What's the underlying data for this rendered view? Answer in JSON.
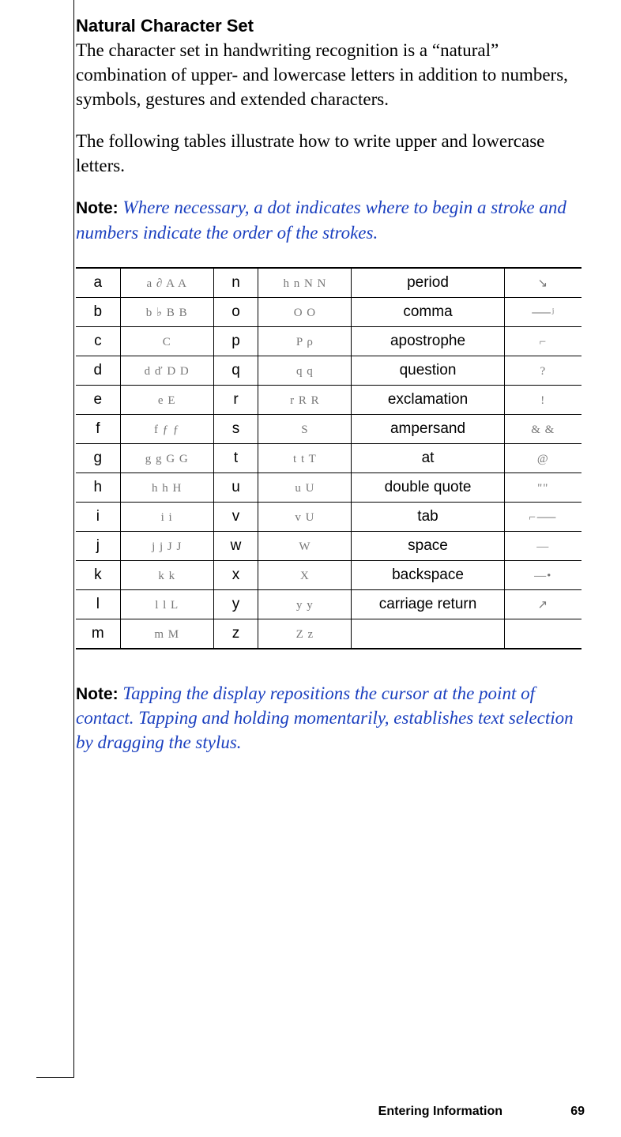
{
  "section": {
    "title": "Natural Character Set",
    "para1": "The character set in handwriting recognition is a “natural” combination of upper- and lowercase letters in addition to numbers, symbols, gestures and extended characters.",
    "para2": "The following tables illustrate how to write upper and lowercase letters."
  },
  "notes": {
    "label": "Note:",
    "note1": "Where necessary, a dot indicates where to begin a stroke and numbers indicate the order of the strokes.",
    "note2": "Tapping the display repositions the cursor at the point of contact. Tapping and holding momentarily, establishes text selection by dragging the stylus."
  },
  "table": {
    "rows": [
      {
        "l1": "a",
        "l2": "n",
        "p": "period"
      },
      {
        "l1": "b",
        "l2": "o",
        "p": "comma"
      },
      {
        "l1": "c",
        "l2": "p",
        "p": "apostrophe"
      },
      {
        "l1": "d",
        "l2": "q",
        "p": "question"
      },
      {
        "l1": "e",
        "l2": "r",
        "p": "exclamation"
      },
      {
        "l1": "f",
        "l2": "s",
        "p": "ampersand"
      },
      {
        "l1": "g",
        "l2": "t",
        "p": "at"
      },
      {
        "l1": "h",
        "l2": "u",
        "p": "double quote"
      },
      {
        "l1": "i",
        "l2": "v",
        "p": "tab"
      },
      {
        "l1": "j",
        "l2": "w",
        "p": "space"
      },
      {
        "l1": "k",
        "l2": "x",
        "p": "backspace"
      },
      {
        "l1": "l",
        "l2": "y",
        "p": "carriage return"
      },
      {
        "l1": "m",
        "l2": "z",
        "p": ""
      }
    ]
  },
  "footer": {
    "chapter": "Entering Information",
    "page": "69"
  },
  "glyph_hints": {
    "a": "a ∂ A A",
    "b": "b ♭ B B",
    "c": "C",
    "d": "d ď D D",
    "e": "e E",
    "f": "f ƒ ƒ",
    "g": "g g G G",
    "h": "h h H",
    "i": "i i",
    "j": "j j J J",
    "k": "k k",
    "l": "l l L",
    "m": "m M",
    "n": "h n N N",
    "o": "O O",
    "p": "P ρ",
    "q": "q q",
    "r": "r R R",
    "s": "S",
    "t": "t t T",
    "u": "u U",
    "v": "v U",
    "w": "W",
    "x": "X",
    "y": "y y",
    "z": "Z z",
    "period": "↘",
    "comma": "⸺ʲ",
    "apostrophe": "⌐",
    "question": "?",
    "exclamation": "!",
    "ampersand": "& &",
    "at": "@",
    "double_quote": "\"\"",
    "tab": "⌐⸺",
    "space": "—",
    "backspace": "—•",
    "carriage_return": "↗"
  }
}
